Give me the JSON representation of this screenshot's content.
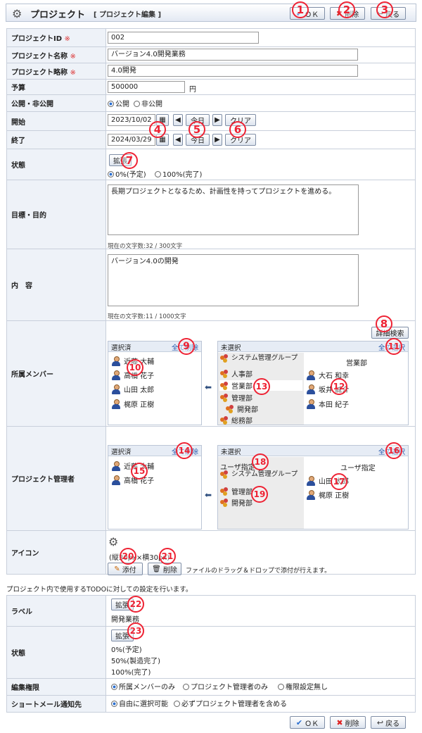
{
  "header": {
    "title": "プロジェクト",
    "subtitle": "[ プロジェクト編集 ]",
    "ok": "ＯＫ",
    "delete": "削除",
    "back": "戻る"
  },
  "fields": {
    "project_id": {
      "label": "プロジェクトID",
      "req": "※",
      "value": "002"
    },
    "project_name": {
      "label": "プロジェクト名称",
      "req": "※",
      "value": "バージョン4.0開発業務"
    },
    "project_short": {
      "label": "プロジェクト略称",
      "req": "※",
      "value": "4.0開発"
    },
    "budget": {
      "label": "予算",
      "value": "500000",
      "unit": "円"
    },
    "visibility": {
      "label": "公開・非公開",
      "opt1": "公開",
      "opt2": "非公開"
    },
    "start": {
      "label": "開始",
      "value": "2023/10/02",
      "today": "今日",
      "clear": "クリア"
    },
    "end": {
      "label": "終了",
      "value": "2024/03/29",
      "today": "今日",
      "clear": "クリア"
    },
    "status": {
      "label": "状態",
      "expand": "拡張",
      "opt1": "0%(予定)",
      "opt2": "100%(完了)"
    },
    "goal": {
      "label": "目標・目的",
      "value": "長期プロジェクトとなるため、計画性を持ってプロジェクトを進める。",
      "count": "現在の文字数:32 / 300文字"
    },
    "content": {
      "label": "内　容",
      "value": "バージョン4.0の開発",
      "count": "現在の文字数:11 / 1000文字"
    }
  },
  "members": {
    "label": "所属メンバー",
    "search": "詳細検索",
    "selected_title": "選択済",
    "delete_all": "全て削除",
    "unselected_title": "未選択",
    "select_all": "全て選択",
    "selected": [
      "近藤 大輔",
      "高橋 花子",
      "山田 太郎",
      "梶原 正樹"
    ],
    "groups": [
      "システム管理グループ",
      "人事部",
      "営業部",
      "管理部",
      "開発部",
      "総務部"
    ],
    "group_name": "営業部",
    "users": [
      "大石 和幸",
      "坂井 誠介",
      "本田 紀子"
    ]
  },
  "admins": {
    "label": "プロジェクト管理者",
    "selected_title": "選択済",
    "delete_all": "全て削除",
    "unselected_title": "未選択",
    "select_all": "全て選択",
    "selected": [
      "近藤 大輔",
      "高橋 花子"
    ],
    "group_header": "ユーザ指定",
    "groups": [
      "システム管理グループ",
      "管理部",
      "開発部"
    ],
    "right_header": "ユーザ指定",
    "users": [
      "山田 太郎",
      "梶原 正樹"
    ]
  },
  "icon": {
    "label": "アイコン",
    "size": "(縦30px×横30px)",
    "attach": "添付",
    "delete": "削除",
    "hint": "ファイルのドラッグ＆ドロップで添付が行えます。"
  },
  "todo_note": "プロジェクト内で使用するTODOに対しての設定を行います。",
  "todo": {
    "label_row": {
      "label": "ラベル",
      "expand": "拡張",
      "value": "開発業務"
    },
    "status_row": {
      "label": "状態",
      "expand": "拡張",
      "v1": "0%(予定)",
      "v2": "50%(製造完了)",
      "v3": "100%(完了)"
    },
    "edit": {
      "label": "編集権限",
      "opt1": "所属メンバーのみ",
      "opt2": "プロジェクト管理者のみ",
      "opt3": "権限設定無し"
    },
    "mail": {
      "label": "ショートメール通知先",
      "opt1": "自由に選択可能",
      "opt2": "必ずプロジェクト管理者を含める"
    }
  },
  "footer": {
    "ok": "ＯＫ",
    "delete": "削除",
    "back": "戻る"
  },
  "markers": [
    "1",
    "2",
    "3",
    "4",
    "5",
    "6",
    "7",
    "8",
    "9",
    "10",
    "11",
    "12",
    "13",
    "14",
    "15",
    "16",
    "17",
    "18",
    "19",
    "20",
    "21",
    "22",
    "23"
  ],
  "colors": {
    "marker": "#ee2233",
    "label_bg": "#eef2f8",
    "link": "#2255aa"
  }
}
